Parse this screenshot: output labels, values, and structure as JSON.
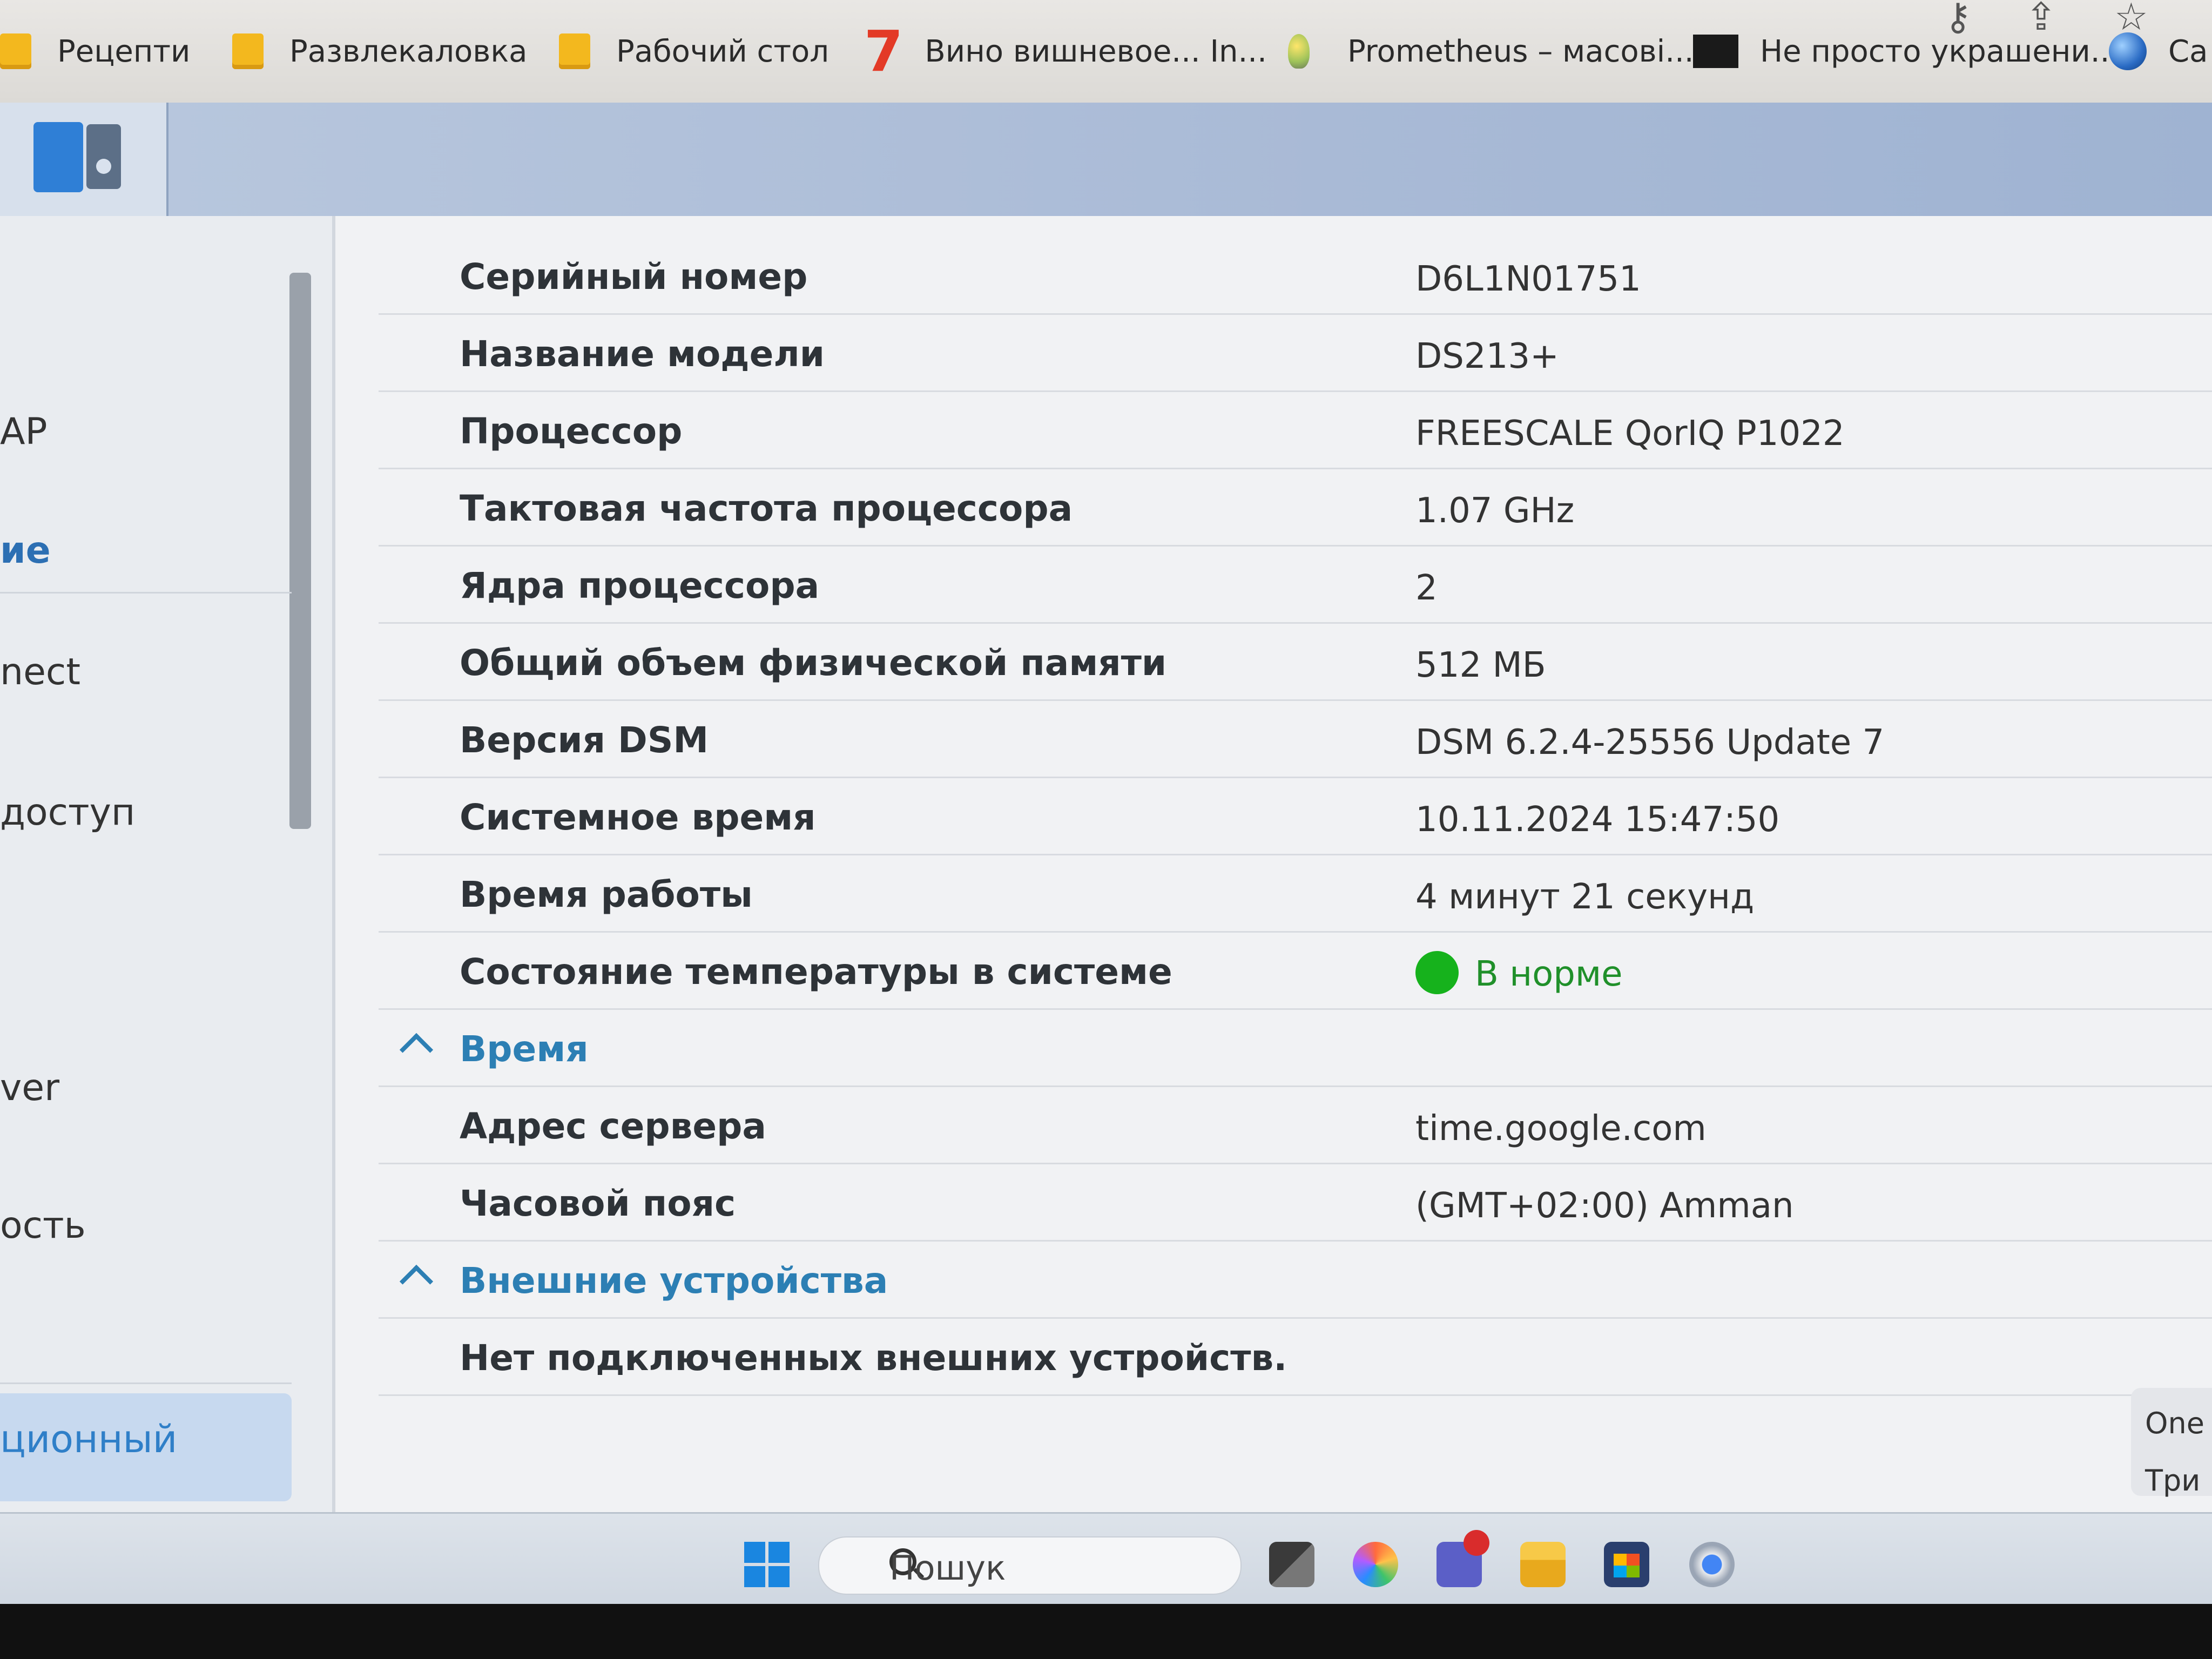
{
  "bookmarks": [
    {
      "label": "Рецепти",
      "icon": "folder-icon"
    },
    {
      "label": "Развлекаловка",
      "icon": "folder-icon"
    },
    {
      "label": "Рабочий стол",
      "icon": "folder-icon"
    },
    {
      "label": "Вино вишневое... In...",
      "icon": "seven-icon",
      "icon_text": "7"
    },
    {
      "label": "Prometheus – масові...",
      "icon": "lightbulb-icon"
    },
    {
      "label": "Не просто украшени...",
      "icon": "dark-site-icon"
    },
    {
      "label": "Са",
      "icon": "globe-icon"
    }
  ],
  "sidebar": {
    "items": [
      {
        "label": "AP",
        "active": false
      },
      {
        "label": "ие",
        "active": true
      },
      {
        "label": "nect",
        "active": false
      },
      {
        "label": "доступ",
        "active": false
      },
      {
        "label": "ver",
        "active": false
      },
      {
        "label": "ость",
        "active": false
      }
    ],
    "selected_label": "ционный"
  },
  "info_rows": [
    {
      "label": "Серийный номер",
      "value": "D6L1N01751"
    },
    {
      "label": "Название модели",
      "value": "DS213+"
    },
    {
      "label": "Процессор",
      "value": "FREESCALE QorIQ P1022"
    },
    {
      "label": "Тактовая частота процессора",
      "value": "1.07 GHz"
    },
    {
      "label": "Ядра процессора",
      "value": "2"
    },
    {
      "label": "Общий объем физической памяти",
      "value": "512 МБ"
    },
    {
      "label": "Версия DSM",
      "value": "DSM 6.2.4-25556 Update 7"
    },
    {
      "label": "Системное время",
      "value": "10.11.2024 15:47:50"
    },
    {
      "label": "Время работы",
      "value": "4 минут 21 секунд"
    },
    {
      "label": "Состояние температуры в системе",
      "value": "В норме",
      "status_color": "#16b21c"
    }
  ],
  "time_section": {
    "title": "Время",
    "rows": [
      {
        "label": "Адрес сервера",
        "value": "time.google.com"
      },
      {
        "label": "Часовой пояс",
        "value": "(GMT+02:00) Amman"
      }
    ]
  },
  "devices_section": {
    "title": "Внешние устройства",
    "message": "Нет подключенных внешних устройств."
  },
  "corner_tab": {
    "line1": "One",
    "line2": "Три"
  },
  "taskbar": {
    "search_placeholder": "Пошук"
  },
  "colors": {
    "accent": "#2c7fb4",
    "status_ok": "#16b21c",
    "header": "#a9bad6"
  }
}
